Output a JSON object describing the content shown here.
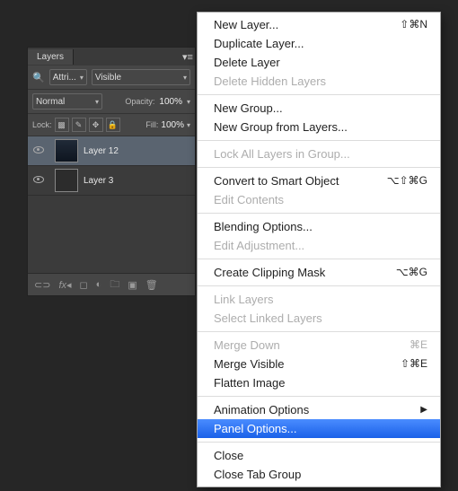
{
  "panel": {
    "title": "Layers",
    "filter": {
      "search_icon": "Attri...",
      "visible": "Visible"
    },
    "blend": {
      "mode": "Normal",
      "opacity_label": "Opacity:",
      "opacity_value": "100%"
    },
    "lock": {
      "label": "Lock:",
      "fill_label": "Fill:",
      "fill_value": "100%"
    },
    "layers": [
      {
        "name": "Layer 12",
        "selected": true
      },
      {
        "name": "Layer 3",
        "selected": false
      }
    ]
  },
  "menu": {
    "items": [
      {
        "label": "New Layer...",
        "shortcut": "⇧⌘N"
      },
      {
        "label": "Duplicate Layer..."
      },
      {
        "label": "Delete Layer"
      },
      {
        "label": "Delete Hidden Layers",
        "disabled": true
      },
      {
        "sep": true
      },
      {
        "label": "New Group..."
      },
      {
        "label": "New Group from Layers..."
      },
      {
        "sep": true
      },
      {
        "label": "Lock All Layers in Group...",
        "disabled": true
      },
      {
        "sep": true
      },
      {
        "label": "Convert to Smart Object",
        "shortcut": "⌥⇧⌘G"
      },
      {
        "label": "Edit Contents",
        "disabled": true
      },
      {
        "sep": true
      },
      {
        "label": "Blending Options..."
      },
      {
        "label": "Edit Adjustment...",
        "disabled": true
      },
      {
        "sep": true
      },
      {
        "label": "Create Clipping Mask",
        "shortcut": "⌥⌘G"
      },
      {
        "sep": true
      },
      {
        "label": "Link Layers",
        "disabled": true
      },
      {
        "label": "Select Linked Layers",
        "disabled": true
      },
      {
        "sep": true
      },
      {
        "label": "Merge Down",
        "disabled": true,
        "shortcut": "⌘E"
      },
      {
        "label": "Merge Visible",
        "shortcut": "⇧⌘E"
      },
      {
        "label": "Flatten Image"
      },
      {
        "sep": true
      },
      {
        "label": "Animation Options",
        "submenu": true
      },
      {
        "label": "Panel Options...",
        "highlight": true
      },
      {
        "sep": true
      },
      {
        "label": "Close"
      },
      {
        "label": "Close Tab Group"
      }
    ]
  }
}
